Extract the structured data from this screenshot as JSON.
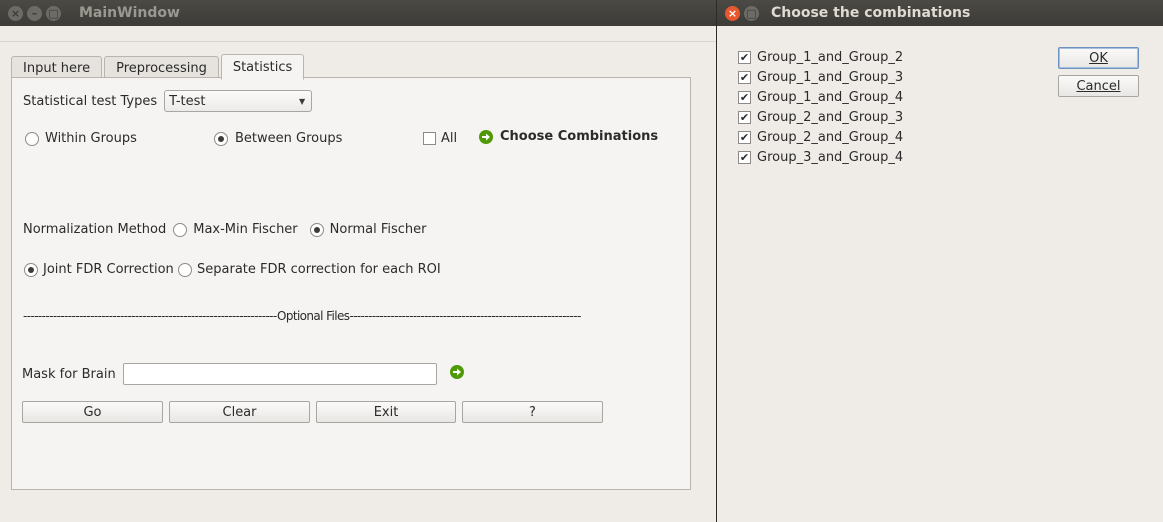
{
  "main_window": {
    "title": "MainWindow",
    "tabs": [
      {
        "label": "Input here",
        "active": false
      },
      {
        "label": "Preprocessing",
        "active": false
      },
      {
        "label": "Statistics",
        "active": true
      }
    ],
    "statistical_test": {
      "label": "Statistical test Types",
      "selected": "T-test"
    },
    "group_mode": {
      "within_label": "Within Groups",
      "between_label": "Between Groups",
      "selected": "Between Groups"
    },
    "all_label": "All",
    "choose_combinations_label": "Choose Combinations",
    "normalization": {
      "label": "Normalization Method",
      "options": [
        "Max-Min Fischer",
        "Normal Fischer"
      ],
      "selected": "Normal Fischer"
    },
    "fdr": {
      "options": [
        "Joint FDR Correction",
        "Separate FDR correction for each ROI"
      ],
      "selected": "Joint FDR Correction"
    },
    "optional_files_separator": "--------------------------------------------------------------------Optional Files--------------------------------------------------------------",
    "mask": {
      "label": "Mask for Brain",
      "value": ""
    },
    "buttons": {
      "go": "Go",
      "clear": "Clear",
      "exit": "Exit",
      "help": "?"
    }
  },
  "dialog": {
    "title": "Choose the combinations",
    "items": [
      {
        "label": "Group_1_and_Group_2",
        "checked": true
      },
      {
        "label": "Group_1_and_Group_3",
        "checked": true
      },
      {
        "label": "Group_1_and_Group_4",
        "checked": true
      },
      {
        "label": "Group_2_and_Group_3",
        "checked": true
      },
      {
        "label": "Group_2_and_Group_4",
        "checked": true
      },
      {
        "label": "Group_3_and_Group_4",
        "checked": true
      }
    ],
    "ok_label": "OK",
    "cancel_label": "Cancel"
  },
  "icons": {
    "close": "close-icon",
    "minimize": "minimize-icon",
    "maximize": "maximize-icon",
    "arrow": "green-arrow-icon",
    "check": "✔"
  },
  "colors": {
    "titlebar": "#3c3b37",
    "window_bg": "#efebe7",
    "close_active": "#e8582f",
    "arrow_green": "#4e9a06"
  }
}
